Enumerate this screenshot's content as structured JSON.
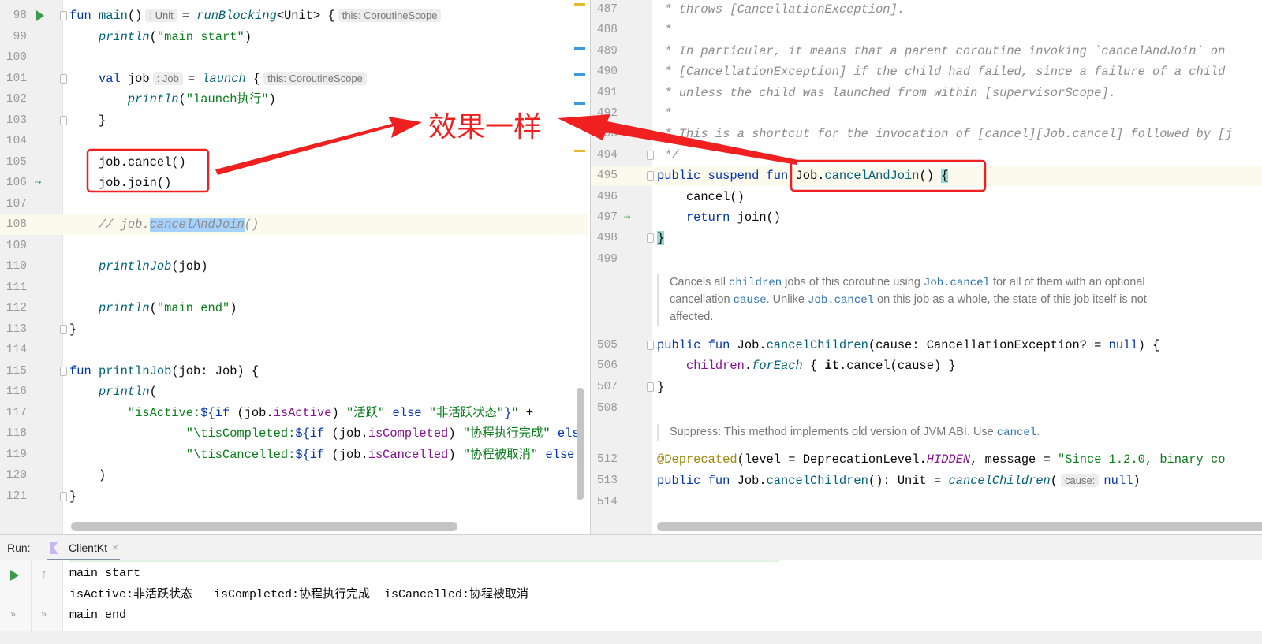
{
  "left_editor": {
    "lines": [
      {
        "num": "98",
        "run": true,
        "fold": true,
        "segs": [
          [
            "k",
            "fun "
          ],
          [
            "fd",
            "main"
          ],
          [
            "p",
            "()"
          ],
          [
            "h",
            ": Unit"
          ],
          [
            "p",
            "= "
          ],
          [
            "f",
            "runBlocking"
          ],
          [
            "p",
            "<Unit> {"
          ],
          [
            "h",
            "this: CoroutineScope"
          ]
        ]
      },
      {
        "num": "99",
        "segs": [
          [
            "p",
            "    "
          ],
          [
            "f",
            "println"
          ],
          [
            "p",
            "("
          ],
          [
            "s",
            "\"main start\""
          ],
          [
            "p",
            ")"
          ]
        ]
      },
      {
        "num": "100",
        "segs": []
      },
      {
        "num": "101",
        "fold": true,
        "segs": [
          [
            "p",
            "    "
          ],
          [
            "k",
            "val "
          ],
          [
            "p",
            "job"
          ],
          [
            "h",
            ": Job"
          ],
          [
            "p",
            "= "
          ],
          [
            "f",
            "launch"
          ],
          [
            "p",
            " {"
          ],
          [
            "h",
            "this: CoroutineScope"
          ]
        ]
      },
      {
        "num": "102",
        "segs": [
          [
            "p",
            "        "
          ],
          [
            "f",
            "println"
          ],
          [
            "p",
            "("
          ],
          [
            "s",
            "\"launch执行\""
          ],
          [
            "p",
            ")"
          ]
        ]
      },
      {
        "num": "103",
        "fold": true,
        "segs": [
          [
            "p",
            "    }"
          ]
        ]
      },
      {
        "num": "104",
        "segs": []
      },
      {
        "num": "105",
        "segs": [
          [
            "p",
            "    job.cancel()"
          ]
        ]
      },
      {
        "num": "106",
        "suspend": true,
        "segs": [
          [
            "p",
            "    job.join()"
          ]
        ]
      },
      {
        "num": "107",
        "segs": []
      },
      {
        "num": "108",
        "current": true,
        "segs": [
          [
            "p",
            "    "
          ],
          [
            "c",
            "// job."
          ],
          [
            "csel",
            "cancelAndJoin"
          ],
          [
            "c",
            "()"
          ]
        ]
      },
      {
        "num": "109",
        "segs": []
      },
      {
        "num": "110",
        "segs": [
          [
            "p",
            "    "
          ],
          [
            "f",
            "printlnJob"
          ],
          [
            "p",
            "(job)"
          ]
        ]
      },
      {
        "num": "111",
        "segs": []
      },
      {
        "num": "112",
        "segs": [
          [
            "p",
            "    "
          ],
          [
            "f",
            "println"
          ],
          [
            "p",
            "("
          ],
          [
            "s",
            "\"main end\""
          ],
          [
            "p",
            ")"
          ]
        ]
      },
      {
        "num": "113",
        "fold": true,
        "segs": [
          [
            "p",
            "}"
          ]
        ]
      },
      {
        "num": "114",
        "segs": []
      },
      {
        "num": "115",
        "fold": true,
        "segs": [
          [
            "k",
            "fun "
          ],
          [
            "fd",
            "printlnJob"
          ],
          [
            "p",
            "(job: Job) {"
          ]
        ]
      },
      {
        "num": "116",
        "segs": [
          [
            "p",
            "    "
          ],
          [
            "f",
            "println"
          ],
          [
            "p",
            "("
          ]
        ]
      },
      {
        "num": "117",
        "segs": [
          [
            "p",
            "        "
          ],
          [
            "s",
            "\"isActive:"
          ],
          [
            "k",
            "${if"
          ],
          [
            "p",
            " (job."
          ],
          [
            "prop",
            "isActive"
          ],
          [
            "p",
            ") "
          ],
          [
            "s",
            "\"活跃\""
          ],
          [
            "k",
            " else "
          ],
          [
            "s",
            "\"非活跃状态\""
          ],
          [
            "k",
            "}"
          ],
          [
            "s",
            "\""
          ],
          [
            "p",
            " +"
          ]
        ]
      },
      {
        "num": "118",
        "segs": [
          [
            "p",
            "                "
          ],
          [
            "s",
            "\"\\tisCompleted:"
          ],
          [
            "k",
            "${if"
          ],
          [
            "p",
            " (job."
          ],
          [
            "prop",
            "isCompleted"
          ],
          [
            "p",
            ") "
          ],
          [
            "s",
            "\"协程执行完成\""
          ],
          [
            "k",
            " els"
          ]
        ]
      },
      {
        "num": "119",
        "segs": [
          [
            "p",
            "                "
          ],
          [
            "s",
            "\"\\tisCancelled:"
          ],
          [
            "k",
            "${if"
          ],
          [
            "p",
            " (job."
          ],
          [
            "prop",
            "isCancelled"
          ],
          [
            "p",
            ") "
          ],
          [
            "s",
            "\"协程被取消\""
          ],
          [
            "k",
            " else"
          ]
        ]
      },
      {
        "num": "120",
        "segs": [
          [
            "p",
            "    )"
          ]
        ]
      },
      {
        "num": "121",
        "fold": true,
        "segs": [
          [
            "p",
            "}"
          ]
        ]
      }
    ]
  },
  "right_editor": {
    "lines": [
      {
        "num": "487",
        "segs": [
          [
            "c",
            " * throws [CancellationException]."
          ]
        ]
      },
      {
        "num": "488",
        "segs": [
          [
            "c",
            " *"
          ]
        ]
      },
      {
        "num": "489",
        "segs": [
          [
            "c",
            " * In particular, it means that a parent coroutine invoking `cancelAndJoin` on"
          ]
        ]
      },
      {
        "num": "490",
        "segs": [
          [
            "c",
            " * [CancellationException] if the child had failed, since a failure of a child"
          ]
        ]
      },
      {
        "num": "491",
        "segs": [
          [
            "c",
            " * unless the child was launched from within [supervisorScope]."
          ]
        ]
      },
      {
        "num": "492",
        "segs": [
          [
            "c",
            " *"
          ]
        ]
      },
      {
        "num": "493",
        "segs": [
          [
            "c",
            " * This is a shortcut for the invocation of [cancel][Job.cancel] followed by [j"
          ]
        ]
      },
      {
        "num": "494",
        "fold": true,
        "segs": [
          [
            "c",
            " */"
          ]
        ]
      },
      {
        "num": "495",
        "current": true,
        "fold": true,
        "segs": [
          [
            "k",
            "public suspend fun "
          ],
          [
            "p",
            "Job."
          ],
          [
            "fd",
            "cancelAndJoin"
          ],
          [
            "p",
            "() "
          ],
          [
            "brace",
            "{"
          ]
        ]
      },
      {
        "num": "496",
        "segs": [
          [
            "p",
            "    cancel()"
          ]
        ]
      },
      {
        "num": "497",
        "suspend": true,
        "segs": [
          [
            "k",
            "    return "
          ],
          [
            "p",
            "join()"
          ]
        ]
      },
      {
        "num": "498",
        "fold": true,
        "segs": [
          [
            "brace",
            "}"
          ]
        ]
      },
      {
        "num": "499",
        "segs": []
      },
      {
        "num": "505",
        "fold": true,
        "segs": [
          [
            "k",
            "public fun "
          ],
          [
            "p",
            "Job."
          ],
          [
            "fd",
            "cancelChildren"
          ],
          [
            "p",
            "(cause: CancellationException? = "
          ],
          [
            "k",
            "null"
          ],
          [
            "p",
            ") {"
          ]
        ]
      },
      {
        "num": "506",
        "segs": [
          [
            "p",
            "    "
          ],
          [
            "prop",
            "children"
          ],
          [
            "p",
            "."
          ],
          [
            "f",
            "forEach"
          ],
          [
            "p",
            " { "
          ],
          [
            "b",
            "it"
          ],
          [
            "p",
            ".cancel(cause) }"
          ]
        ]
      },
      {
        "num": "507",
        "fold": true,
        "segs": [
          [
            "p",
            "}"
          ]
        ]
      },
      {
        "num": "508",
        "segs": []
      },
      {
        "num": "512",
        "segs": [
          [
            "ann",
            "@Deprecated"
          ],
          [
            "p",
            "(level = DeprecationLevel."
          ],
          [
            "cst",
            "HIDDEN"
          ],
          [
            "p",
            ", message = "
          ],
          [
            "s",
            "\"Since 1.2.0, binary co"
          ]
        ]
      },
      {
        "num": "513",
        "segs": [
          [
            "k",
            "public fun "
          ],
          [
            "p",
            "Job."
          ],
          [
            "fd",
            "cancelChildren"
          ],
          [
            "p",
            "(): Unit = "
          ],
          [
            "f",
            "cancelChildren"
          ],
          [
            "p",
            "("
          ],
          [
            "h",
            "cause:"
          ],
          [
            "k",
            "null"
          ],
          [
            "p",
            ")"
          ]
        ]
      },
      {
        "num": "514",
        "segs": []
      }
    ],
    "docs": [
      {
        "segs": [
          [
            "t",
            "Cancels all "
          ],
          [
            "l",
            "children"
          ],
          [
            "t",
            " jobs of this coroutine using "
          ],
          [
            "l",
            "Job.cancel"
          ],
          [
            "t",
            " for all of them with an optional cancellation "
          ],
          [
            "l",
            "cause"
          ],
          [
            "t",
            ". Unlike "
          ],
          [
            "l",
            "Job.cancel"
          ],
          [
            "t",
            " on this job as a whole, the state of this job itself is not affected."
          ]
        ]
      },
      {
        "segs": [
          [
            "t",
            "Suppress: This method implements old version of JVM ABI. Use "
          ],
          [
            "l",
            "cancel"
          ],
          [
            "t",
            "."
          ]
        ]
      }
    ]
  },
  "annotation": {
    "text": "效果一样",
    "color": "#f02020"
  },
  "run_panel": {
    "label": "Run:",
    "tab": "ClientKt",
    "close_icon": "×",
    "output": [
      "main start",
      "isActive:非活跃状态   isCompleted:协程执行完成  isCancelled:协程被取消",
      "main end"
    ],
    "icons": [
      "run-icon",
      "up-arrow-icon",
      "expand-icon"
    ]
  },
  "colors": {
    "keyword": "#0033b3",
    "function": "#00627a",
    "string": "#067d17",
    "property": "#871094",
    "comment": "#8c8c8c",
    "annotation_red": "#f02020"
  }
}
